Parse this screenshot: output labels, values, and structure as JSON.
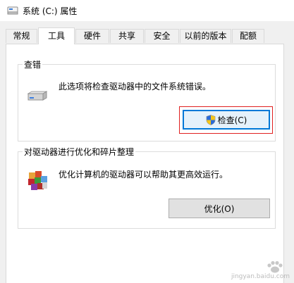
{
  "window": {
    "title": "系统 (C:) 属性",
    "icon": "drive-icon"
  },
  "tabs": [
    {
      "label": "常规",
      "active": false
    },
    {
      "label": "工具",
      "active": true
    },
    {
      "label": "硬件",
      "active": false
    },
    {
      "label": "共享",
      "active": false
    },
    {
      "label": "安全",
      "active": false
    },
    {
      "label": "以前的版本",
      "active": false
    },
    {
      "label": "配额",
      "active": false
    }
  ],
  "error_checking": {
    "title": "查错",
    "description": "此选项将检查驱动器中的文件系统错误。",
    "icon": "hard-drive-icon",
    "button_label": "检查(C)",
    "button_icon": "uac-shield-icon"
  },
  "optimize": {
    "title": "对驱动器进行优化和碎片整理",
    "description": "优化计算机的驱动器可以帮助其更高效运行。",
    "icon": "defrag-icon",
    "button_label": "优化(O)"
  },
  "watermark": {
    "text": "jingyan.baidu.com"
  },
  "colors": {
    "focus_border": "#0078d7",
    "highlight_box": "#e02020",
    "window_bg": "#f0f0f0",
    "panel_bg": "#ffffff"
  }
}
